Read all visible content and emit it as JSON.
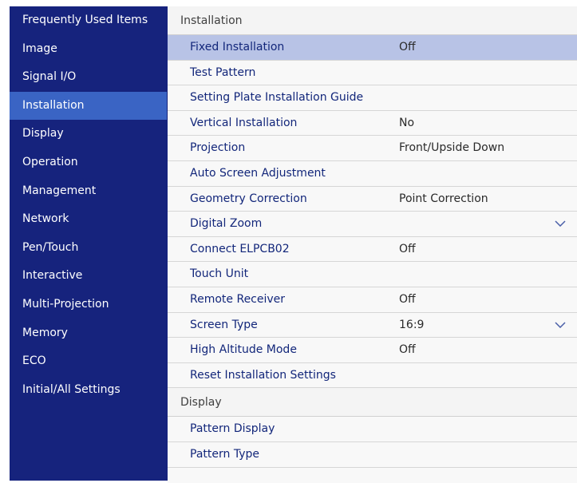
{
  "sidebar": {
    "items": [
      {
        "label": "Frequently Used Items"
      },
      {
        "label": "Image"
      },
      {
        "label": "Signal I/O"
      },
      {
        "label": "Installation"
      },
      {
        "label": "Display"
      },
      {
        "label": "Operation"
      },
      {
        "label": "Management"
      },
      {
        "label": "Network"
      },
      {
        "label": "Pen/Touch"
      },
      {
        "label": "Interactive"
      },
      {
        "label": "Multi-Projection"
      },
      {
        "label": "Memory"
      },
      {
        "label": "ECO"
      },
      {
        "label": "Initial/All Settings"
      }
    ],
    "active_item": "Installation"
  },
  "installation": {
    "header": "Installation",
    "rows": [
      {
        "label": "Fixed Installation",
        "value": "Off"
      },
      {
        "label": "Test Pattern",
        "value": ""
      },
      {
        "label": "Setting Plate Installation Guide",
        "value": ""
      },
      {
        "label": "Vertical Installation",
        "value": "No"
      },
      {
        "label": "Projection",
        "value": "Front/Upside Down"
      },
      {
        "label": "Auto Screen Adjustment",
        "value": ""
      },
      {
        "label": "Geometry Correction",
        "value": "Point Correction"
      },
      {
        "label": "Digital Zoom",
        "value": "",
        "icon": "chevron-down-icon"
      },
      {
        "label": "Connect ELPCB02",
        "value": "Off"
      },
      {
        "label": "Touch Unit",
        "value": ""
      },
      {
        "label": "Remote Receiver",
        "value": "Off"
      },
      {
        "label": "Screen Type",
        "value": "16:9",
        "icon": "chevron-down-icon"
      },
      {
        "label": "High Altitude Mode",
        "value": "Off"
      },
      {
        "label": "Reset Installation Settings",
        "value": ""
      }
    ]
  },
  "display": {
    "header": "Display",
    "rows": [
      {
        "label": "Pattern Display",
        "value": ""
      },
      {
        "label": "Pattern Type",
        "value": ""
      }
    ]
  },
  "colors": {
    "sidebar_bg": "#16237d",
    "sidebar_active": "#3a64c4",
    "row_selected": "#b8c3e6",
    "row_text": "#12267a"
  }
}
